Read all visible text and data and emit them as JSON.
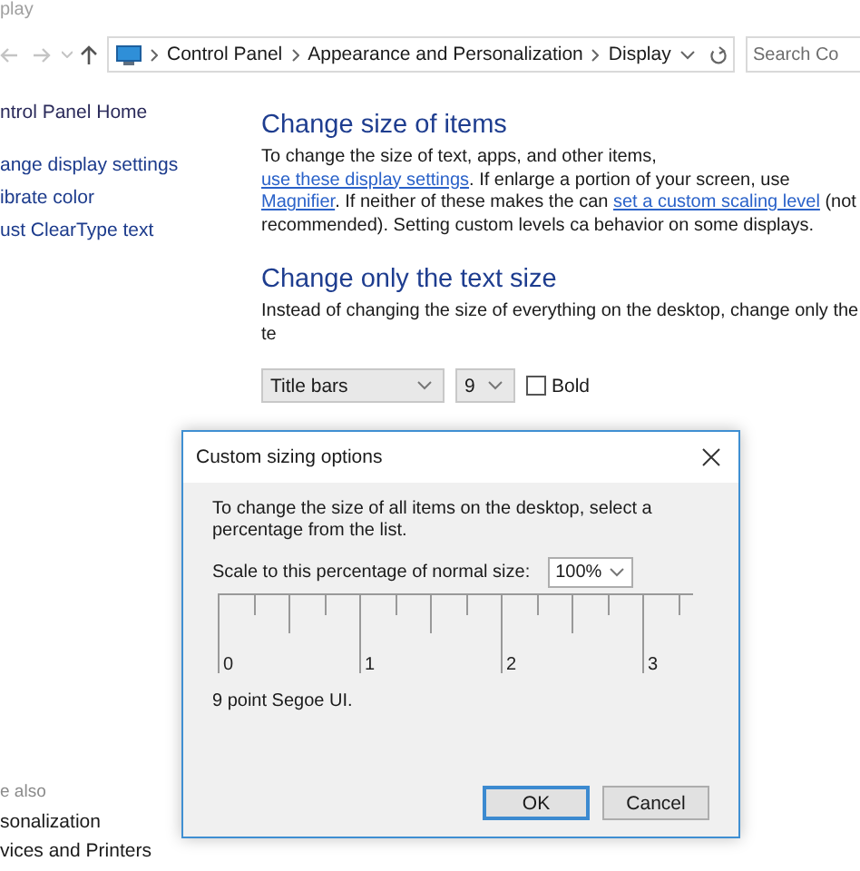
{
  "window": {
    "title": "play"
  },
  "address_bar": {
    "breadcrumbs": [
      "Control Panel",
      "Appearance and Personalization",
      "Display"
    ]
  },
  "search": {
    "placeholder": "Search Co"
  },
  "sidebar": {
    "items": [
      {
        "label": "ntrol Panel Home",
        "kind": "home"
      },
      {
        "label": "ange display settings",
        "kind": "task"
      },
      {
        "label": "ibrate color",
        "kind": "task"
      },
      {
        "label": "ust ClearType text",
        "kind": "task"
      }
    ],
    "see_also": {
      "heading": "e also",
      "items": [
        "sonalization",
        "vices and Printers"
      ]
    }
  },
  "sections": [
    {
      "heading": "Change size of items",
      "body": [
        {
          "kind": "text",
          "text": "To change the size of text, apps, and other items, "
        },
        {
          "kind": "link",
          "text": "use these display settings"
        },
        {
          "kind": "text",
          "text": ".  If enlarge a portion of your screen, use "
        },
        {
          "kind": "link",
          "text": "Magnifier"
        },
        {
          "kind": "text",
          "text": ".  If neither of these makes the can "
        },
        {
          "kind": "link",
          "text": "set a custom scaling level"
        },
        {
          "kind": "text",
          "text": " (not recommended).  Setting custom levels ca behavior on some displays."
        }
      ]
    },
    {
      "heading": "Change only the text size",
      "body": [
        {
          "kind": "text",
          "text": "Instead of changing the size of everything on the desktop, change only the te"
        }
      ]
    }
  ],
  "text_size": {
    "element": "Title bars",
    "size": "9",
    "bold": {
      "label": "Bold",
      "checked": false
    }
  },
  "dialog": {
    "title": "Custom sizing options",
    "message": "To change the size of all items on the desktop, select a percentage from the list.",
    "scale_label": "Scale to this percentage of normal size:",
    "scale": "100%",
    "ruler_labels": [
      "0",
      "1",
      "2",
      "3"
    ],
    "sample": "9 point Segoe UI.",
    "buttons": [
      {
        "label": "OK",
        "default": true
      },
      {
        "label": "Cancel",
        "default": false
      }
    ]
  }
}
